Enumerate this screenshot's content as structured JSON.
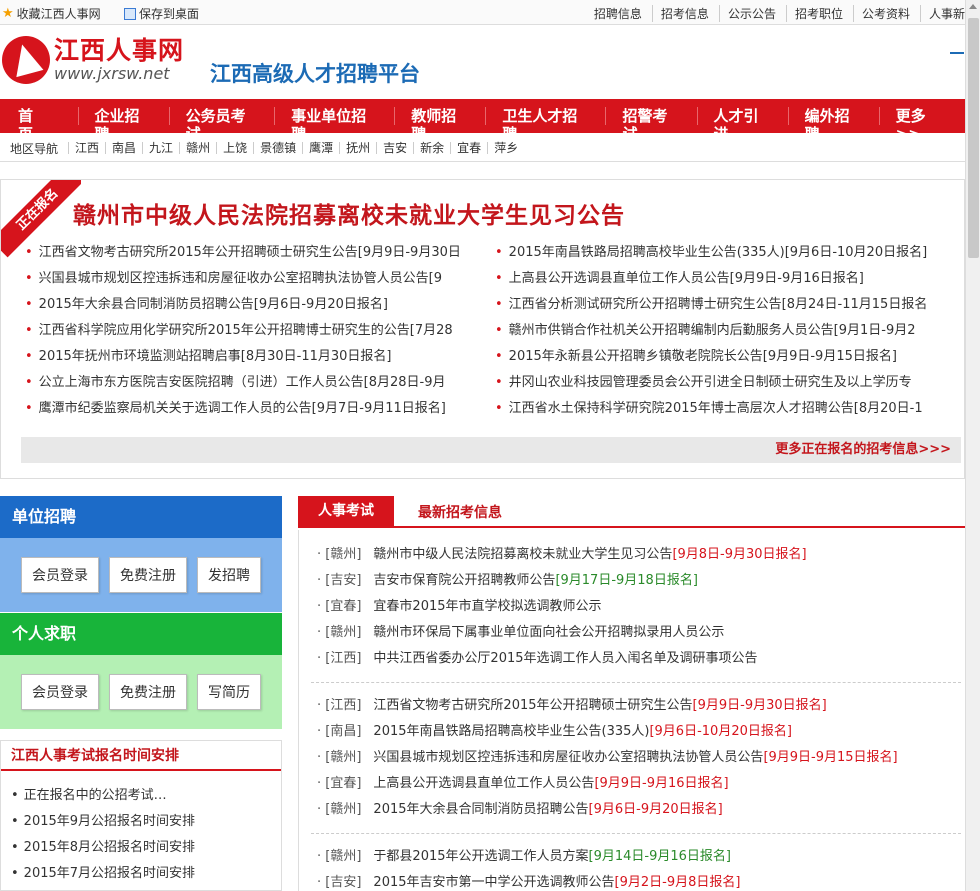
{
  "topbar": {
    "left": [
      "收藏江西人事网",
      "保存到桌面"
    ],
    "right": [
      "招聘信息",
      "招考信息",
      "公示公告",
      "招考职位",
      "公考资料",
      "人事新"
    ]
  },
  "logo": {
    "cn": "江西人事网",
    "url": "www.jxrsw.net"
  },
  "slogan": "江西高级人才招聘平台",
  "nav": [
    "首　页",
    "企业招聘",
    "公务员考试",
    "事业单位招聘",
    "教师招聘",
    "卫生人才招聘",
    "招警考试",
    "人才引进",
    "编外招聘",
    "更多>>"
  ],
  "region": {
    "label": "地区导航",
    "items": [
      "江西",
      "南昌",
      "九江",
      "赣州",
      "上饶",
      "景德镇",
      "鹰潭",
      "抚州",
      "吉安",
      "新余",
      "宜春",
      "萍乡"
    ]
  },
  "banner": {
    "ribbon": "正在报名",
    "headline": "赣州市中级人民法院招募离校未就业大学生见习公告",
    "left": [
      "江西省文物考古研究所2015年公开招聘硕士研究生公告[9月9日-9月30日",
      "兴国县城市规划区控违拆违和房屋征收办公室招聘执法协管人员公告[9",
      "2015年大余县合同制消防员招聘公告[9月6日-9月20日报名]",
      "江西省科学院应用化学研究所2015年公开招聘博士研究生的公告[7月28",
      "2015年抚州市环境监测站招聘启事[8月30日-11月30日报名]",
      "公立上海市东方医院吉安医院招聘（引进）工作人员公告[8月28日-9月",
      "鹰潭市纪委监察局机关关于选调工作人员的公告[9月7日-9月11日报名]"
    ],
    "right": [
      "2015年南昌铁路局招聘高校毕业生公告(335人)[9月6日-10月20日报名]",
      "上高县公开选调县直单位工作人员公告[9月9日-9月16日报名]",
      "江西省分析测试研究所公开招聘博士研究生公告[8月24日-11月15日报名",
      "赣州市供销合作社机关公开招聘编制内后勤服务人员公告[9月1日-9月2",
      "2015年永新县公开招聘乡镇敬老院院长公告[9月9日-9月15日报名]",
      "井冈山农业科技园管理委员会公开引进全日制硕士研究生及以上学历专",
      "江西省水土保持科学研究院2015年博士高层次人才招聘公告[8月20日-1"
    ],
    "more": "更多正在报名的招考信息>>>"
  },
  "unit": {
    "title": "单位招聘",
    "buttons": [
      "会员登录",
      "免费注册",
      "发招聘"
    ]
  },
  "personal": {
    "title": "个人求职",
    "buttons": [
      "会员登录",
      "免费注册",
      "写简历"
    ]
  },
  "schedule": {
    "title": "江西人事考试报名时间安排",
    "items": [
      "正在报名中的公招考试…",
      "2015年9月公招报名时间安排",
      "2015年8月公招报名时间安排",
      "2015年7月公招报名时间安排"
    ]
  },
  "tabs": {
    "active": "人事考试",
    "other": "最新招考信息"
  },
  "groups": [
    [
      {
        "region": "[赣州]",
        "title": "赣州市中级人民法院招募离校未就业大学生见习公告",
        "date": "[9月8日-9月30日报名]",
        "color": "red"
      },
      {
        "region": "[吉安]",
        "title": "吉安市保育院公开招聘教师公告",
        "date": "[9月17日-9月18日报名]",
        "color": "green"
      },
      {
        "region": "[宜春]",
        "title": "宜春市2015年市直学校拟选调教师公示",
        "date": "",
        "color": "red"
      },
      {
        "region": "[赣州]",
        "title": "赣州市环保局下属事业单位面向社会公开招聘拟录用人员公示",
        "date": "",
        "color": "red"
      },
      {
        "region": "[江西]",
        "title": "中共江西省委办公厅2015年选调工作人员入闱名单及调研事项公告",
        "date": "",
        "color": "red"
      }
    ],
    [
      {
        "region": "[江西]",
        "title": "江西省文物考古研究所2015年公开招聘硕士研究生公告",
        "date": "[9月9日-9月30日报名]",
        "color": "red"
      },
      {
        "region": "[南昌]",
        "title": "2015年南昌铁路局招聘高校毕业生公告(335人)",
        "date": "[9月6日-10月20日报名]",
        "color": "red"
      },
      {
        "region": "[赣州]",
        "title": "兴国县城市规划区控违拆违和房屋征收办公室招聘执法协管人员公告",
        "date": "[9月9日-9月15日报名]",
        "color": "red"
      },
      {
        "region": "[宜春]",
        "title": "上高县公开选调县直单位工作人员公告",
        "date": "[9月9日-9月16日报名]",
        "color": "red"
      },
      {
        "region": "[赣州]",
        "title": "2015年大余县合同制消防员招聘公告",
        "date": "[9月6日-9月20日报名]",
        "color": "red"
      }
    ],
    [
      {
        "region": "[赣州]",
        "title": "于都县2015年公开选调工作人员方案",
        "date": "[9月14日-9月16日报名]",
        "color": "green"
      },
      {
        "region": "[吉安]",
        "title": "2015年吉安市第一中学公开选调教师公告",
        "date": "[9月2日-9月8日报名]",
        "color": "red"
      }
    ]
  ]
}
